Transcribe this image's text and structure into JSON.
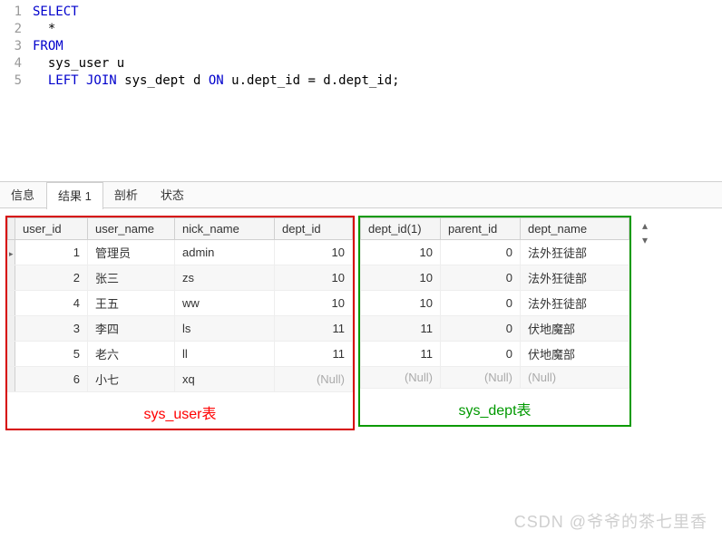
{
  "sql": {
    "lines": [
      {
        "n": 1,
        "tokens": [
          {
            "t": "SELECT",
            "c": "kw"
          }
        ]
      },
      {
        "n": 2,
        "tokens": [
          {
            "t": "  *",
            "c": "plain"
          }
        ]
      },
      {
        "n": 3,
        "tokens": [
          {
            "t": "FROM",
            "c": "kw"
          }
        ]
      },
      {
        "n": 4,
        "tokens": [
          {
            "t": "  sys_user u",
            "c": "plain"
          }
        ]
      },
      {
        "n": 5,
        "tokens": [
          {
            "t": "  ",
            "c": "plain"
          },
          {
            "t": "LEFT JOIN",
            "c": "kw"
          },
          {
            "t": " sys_dept d ",
            "c": "plain"
          },
          {
            "t": "ON",
            "c": "kw"
          },
          {
            "t": " u.dept_id = d.dept_id;",
            "c": "plain"
          }
        ]
      }
    ]
  },
  "tabs": {
    "items": [
      "信息",
      "结果 1",
      "剖析",
      "状态"
    ],
    "activeIndex": 1
  },
  "table_user": {
    "caption": "sys_user表",
    "headers": [
      "user_id",
      "user_name",
      "nick_name",
      "dept_id"
    ],
    "rows": [
      {
        "user_id": 1,
        "user_name": "管理员",
        "nick_name": "admin",
        "dept_id": 10
      },
      {
        "user_id": 2,
        "user_name": "张三",
        "nick_name": "zs",
        "dept_id": 10
      },
      {
        "user_id": 4,
        "user_name": "王五",
        "nick_name": "ww",
        "dept_id": 10
      },
      {
        "user_id": 3,
        "user_name": "李四",
        "nick_name": "ls",
        "dept_id": 11
      },
      {
        "user_id": 5,
        "user_name": "老六",
        "nick_name": "ll",
        "dept_id": 11
      },
      {
        "user_id": 6,
        "user_name": "小七",
        "nick_name": "xq",
        "dept_id": null
      }
    ]
  },
  "table_dept": {
    "caption": "sys_dept表",
    "headers": [
      "dept_id(1)",
      "parent_id",
      "dept_name"
    ],
    "rows": [
      {
        "dept_id": 10,
        "parent_id": 0,
        "dept_name": "法外狂徒部"
      },
      {
        "dept_id": 10,
        "parent_id": 0,
        "dept_name": "法外狂徒部"
      },
      {
        "dept_id": 10,
        "parent_id": 0,
        "dept_name": "法外狂徒部"
      },
      {
        "dept_id": 11,
        "parent_id": 0,
        "dept_name": "伏地魔部"
      },
      {
        "dept_id": 11,
        "parent_id": 0,
        "dept_name": "伏地魔部"
      },
      {
        "dept_id": null,
        "parent_id": null,
        "dept_name": null
      }
    ]
  },
  "null_label": "(Null)",
  "watermark": "CSDN @爷爷的茶七里香"
}
